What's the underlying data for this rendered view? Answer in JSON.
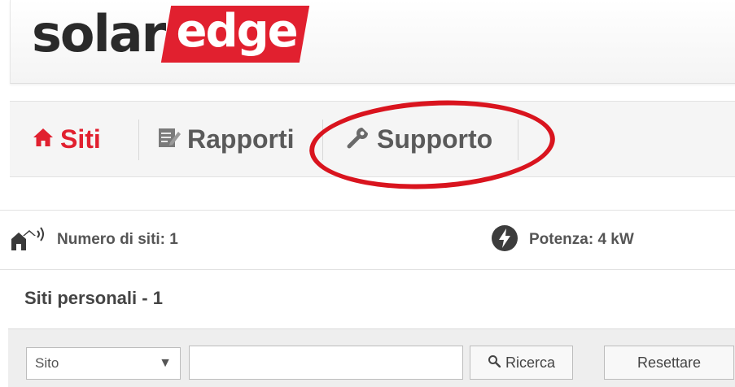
{
  "logo": {
    "part1": "solar",
    "part2": "edge"
  },
  "nav": {
    "tabs": [
      {
        "label": "Siti",
        "icon": "home-icon",
        "active": true
      },
      {
        "label": "Rapporti",
        "icon": "report-icon"
      },
      {
        "label": "Supporto",
        "icon": "wrench-icon"
      }
    ]
  },
  "stats": {
    "sites": "Numero di siti: 1",
    "power": "Potenza: 4 kW"
  },
  "section": {
    "title": "Siti personali - 1"
  },
  "filters": {
    "select_value": "Sito",
    "search_value": "",
    "search_button": "Ricerca",
    "reset_button": "Resettare"
  },
  "colors": {
    "brand_red": "#e1202f",
    "highlight_ring": "#d9141e"
  }
}
